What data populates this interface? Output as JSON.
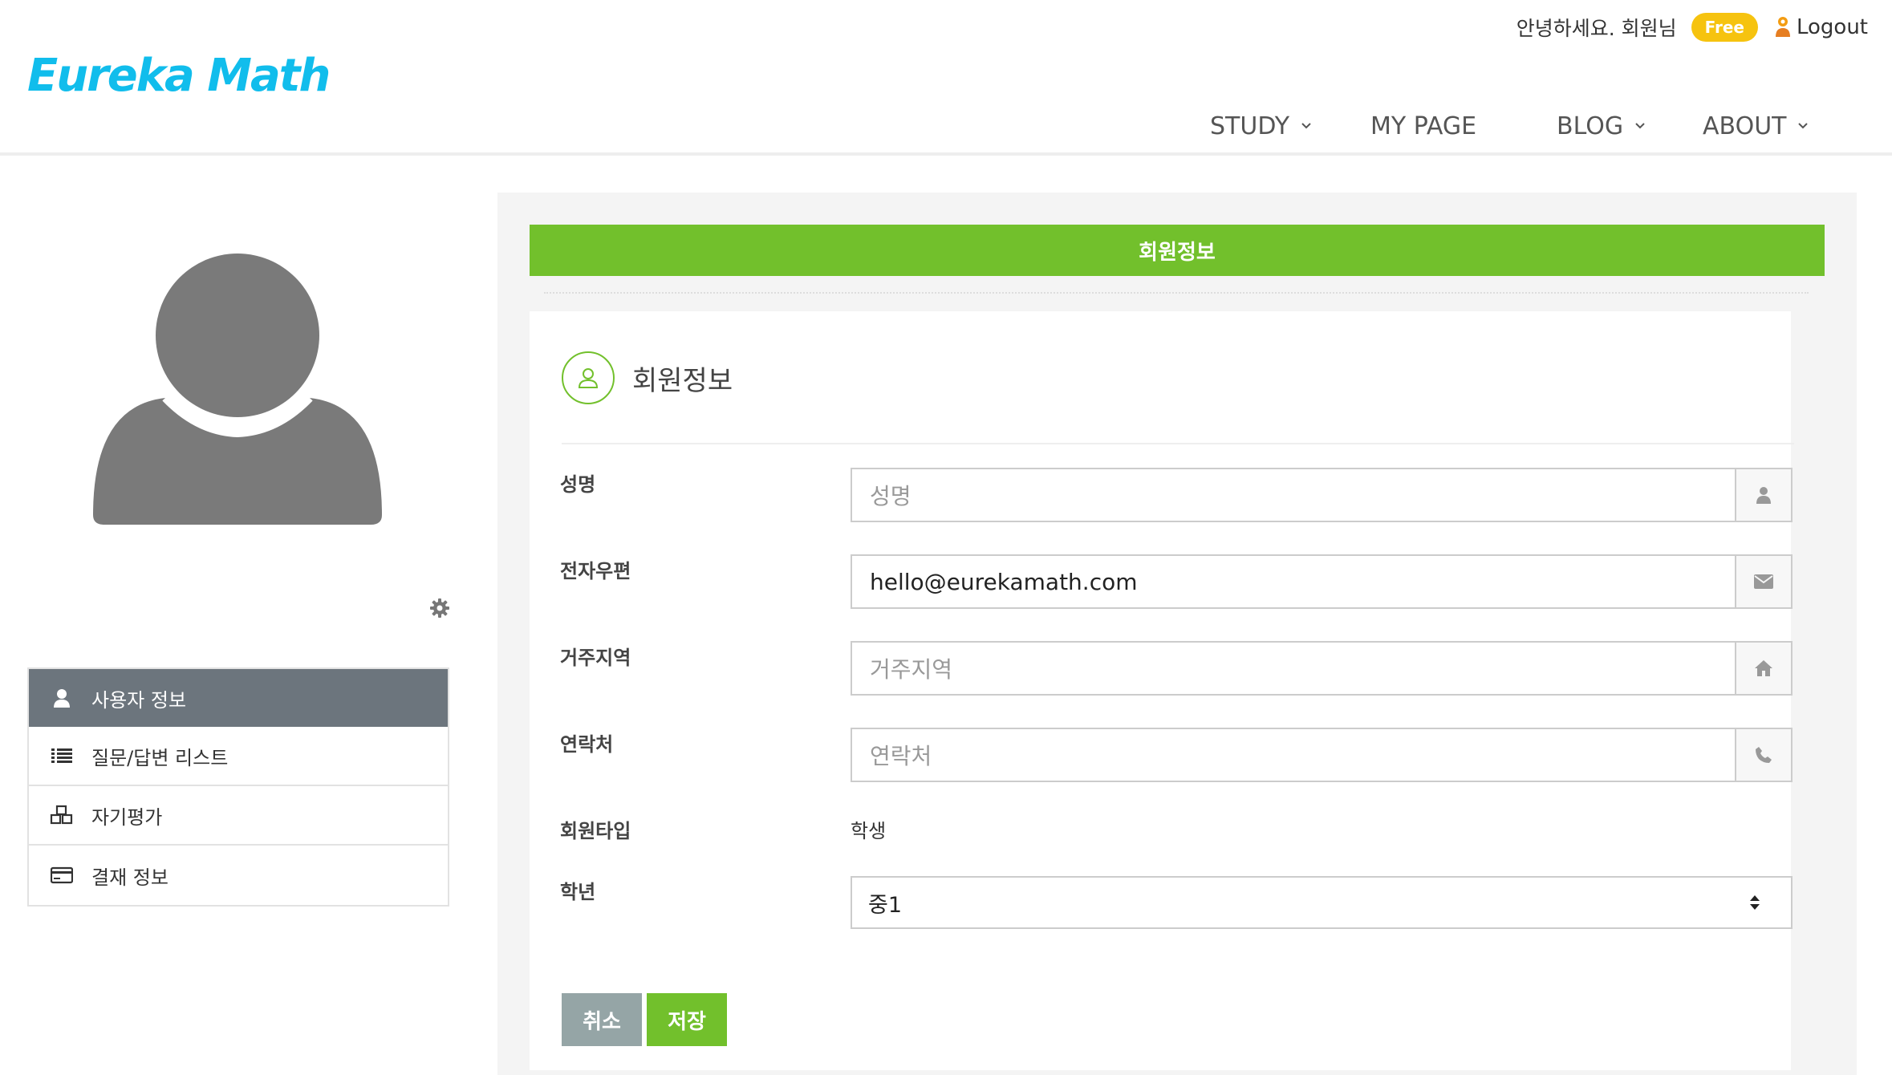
{
  "header": {
    "logo": "Eureka Math",
    "greeting": "안녕하세요. 회원님",
    "plan_badge": "Free",
    "logout_label": "Logout",
    "nav": [
      {
        "label": "STUDY",
        "has_dropdown": true
      },
      {
        "label": "MY PAGE",
        "has_dropdown": false
      },
      {
        "label": "BLOG",
        "has_dropdown": true
      },
      {
        "label": "ABOUT",
        "has_dropdown": true
      }
    ]
  },
  "sidebar": {
    "avatar_icon": "user-silhouette-icon",
    "settings_icon": "gear-icon",
    "items": [
      {
        "label": "사용자 정보",
        "icon": "user-icon",
        "active": true
      },
      {
        "label": "질문/답변 리스트",
        "icon": "list-icon",
        "active": false
      },
      {
        "label": "자기평가",
        "icon": "cubes-icon",
        "active": false
      },
      {
        "label": "결재 정보",
        "icon": "credit-card-icon",
        "active": false
      }
    ]
  },
  "main": {
    "banner_title": "회원정보",
    "section_title": "회원정보",
    "fields": {
      "name": {
        "label": "성명",
        "value": "",
        "placeholder": "성명",
        "icon": "user-icon"
      },
      "email": {
        "label": "전자우편",
        "value": "hello@eurekamath.com",
        "placeholder": "",
        "icon": "envelope-icon"
      },
      "region": {
        "label": "거주지역",
        "value": "",
        "placeholder": "거주지역",
        "icon": "home-icon"
      },
      "phone": {
        "label": "연락처",
        "value": "",
        "placeholder": "연락처",
        "icon": "phone-icon"
      }
    },
    "member_type": {
      "label": "회원타입",
      "value": "학생"
    },
    "grade": {
      "label": "학년",
      "value": "중1"
    },
    "buttons": {
      "cancel": "취소",
      "save": "저장"
    }
  },
  "colors": {
    "brand_blue": "#11bdec",
    "accent_green": "#72c02c",
    "badge_yellow": "#f6c30f",
    "sidebar_active": "#6c757d",
    "cancel_gray": "#95a5a6"
  }
}
